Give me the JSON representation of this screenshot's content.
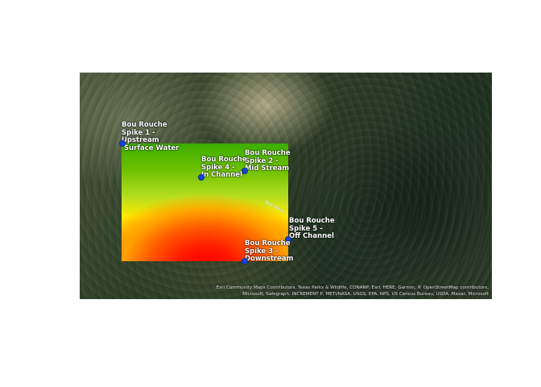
{
  "map": {
    "river_label": "Bou Rouc...",
    "attribution": "Esri Community Maps Contributors, Texas Parks & Wildlife, CONANP, Esri, HERE, Garmin, © OpenStreetMap contributors, Microsoft, Safegraph, INCREMENT P, METI/NASA, USGS, EPA, NPS, US Census Bureau, USDA, Maxar, Microsoft",
    "overlay_gradient_colors": [
      "#3cae00",
      "#b6de20",
      "#ffe800",
      "#ffa000",
      "#ff0000"
    ],
    "marker_color": "#1347d8",
    "sites": [
      {
        "id": "spike1",
        "label": "Bou Rouche\nSpike 1 -\nUpstream\n Surface Water"
      },
      {
        "id": "spike2",
        "label": "Bou Rouche\nSpike 2 -\nMid Stream"
      },
      {
        "id": "spike3",
        "label": "Bou Rouche\nSpike 3 -\nDownstream"
      },
      {
        "id": "spike4",
        "label": "Bou Rouche\nSpike 4 -\nIn Channel"
      },
      {
        "id": "spike5",
        "label": "Bou Rouche\nSpike 5 -\nOff Channel"
      }
    ]
  }
}
